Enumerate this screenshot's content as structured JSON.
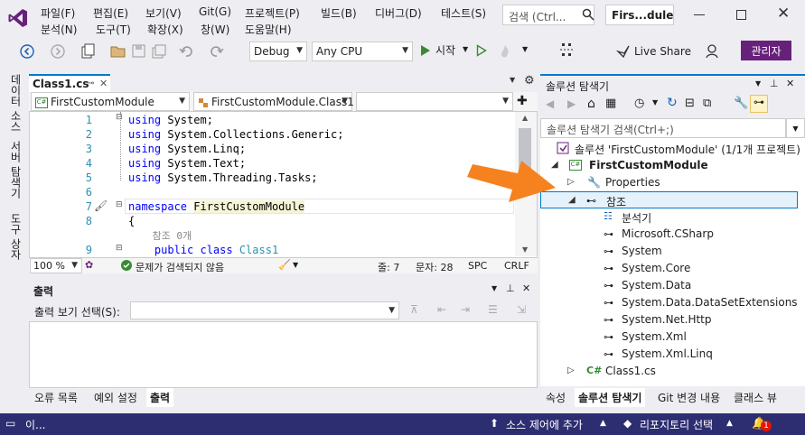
{
  "menu": [
    "파일(F)",
    "편집(E)",
    "보기(V)",
    "Git(G)",
    "프로젝트(P)",
    "빌드(B)",
    "디버그(D)",
    "테스트(S)",
    "분석(N)",
    "도구(T)",
    "확장(X)",
    "창(W)",
    "도움말(H)"
  ],
  "title_search_placeholder": "검색 (Ctrl...",
  "project_badge": "Firs...dule",
  "toolbar": {
    "config": "Debug",
    "platform": "Any CPU",
    "start_label": "시작",
    "liveshare": "Live Share",
    "admin": "관리자"
  },
  "left_tabs": [
    "데이터 소스",
    "서버 탐색기",
    "도구 상자"
  ],
  "editor": {
    "tab_label": "Class1.cs",
    "nav_project": "FirstCustomModule",
    "nav_class": "FirstCustomModule.Class1",
    "lines": [
      {
        "n": "1",
        "code": "using System;"
      },
      {
        "n": "2",
        "code": "using System.Collections.Generic;"
      },
      {
        "n": "3",
        "code": "using System.Linq;"
      },
      {
        "n": "4",
        "code": "using System.Text;"
      },
      {
        "n": "5",
        "code": "using System.Threading.Tasks;"
      },
      {
        "n": "6",
        "code": ""
      },
      {
        "n": "7",
        "code": "namespace FirstCustomModule"
      },
      {
        "n": "8",
        "code": "{"
      },
      {
        "n": "",
        "code": "    참조 0개"
      },
      {
        "n": "9",
        "code": "    public class Class1"
      }
    ],
    "zoom": "100 %",
    "issues": "문제가 검색되지 않음",
    "line_col": "줄: 7",
    "char": "문자: 28",
    "spc": "SPC",
    "crlf": "CRLF"
  },
  "output": {
    "title": "출력",
    "show_label": "출력 보기 선택(S):"
  },
  "bottom_tabs": [
    "오류 목록",
    "예외 설정",
    "출력"
  ],
  "solution_explorer": {
    "title": "솔루션 탐색기",
    "search_placeholder": "솔루션 탐색기 검색(Ctrl+;)",
    "items": [
      {
        "label": "솔루션 'FirstCustomModule' (1/1개 프로젝트)"
      },
      {
        "label": "FirstCustomModule"
      },
      {
        "label": "Properties"
      },
      {
        "label": "참조"
      },
      {
        "label": "분석기"
      },
      {
        "label": "Microsoft.CSharp"
      },
      {
        "label": "System"
      },
      {
        "label": "System.Core"
      },
      {
        "label": "System.Data"
      },
      {
        "label": "System.Data.DataSetExtensions"
      },
      {
        "label": "System.Net.Http"
      },
      {
        "label": "System.Xml"
      },
      {
        "label": "System.Xml.Linq"
      },
      {
        "label": "Class1.cs"
      }
    ]
  },
  "se_tabs": [
    "속성",
    "솔루션 탐색기",
    "Git 변경 내용",
    "클래스 뷰"
  ],
  "statusbar": {
    "ready": "이...",
    "source_control": "소스 제어에 추가",
    "repo": "리포지토리 선택",
    "notif_count": "1"
  },
  "colors": {
    "accent": "#007acc",
    "vs_purple": "#68217a",
    "statusbar": "#2d2d72",
    "arrow": "#f5821f",
    "keyword": "#0000ff",
    "type": "#2b91af"
  }
}
